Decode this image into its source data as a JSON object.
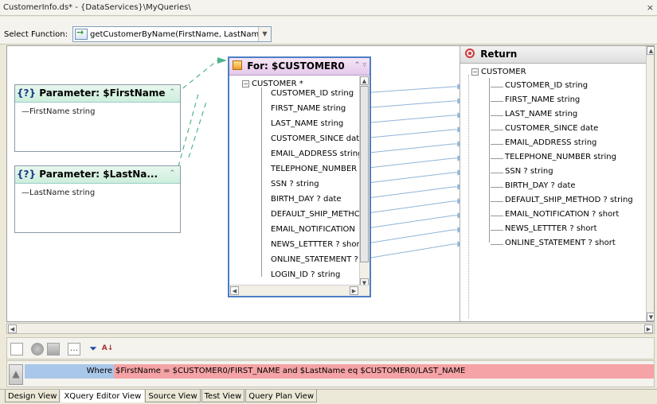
{
  "window": {
    "title": "CustomerInfo.ds* - {DataServices}\\MyQueries\\",
    "close_glyph": "×"
  },
  "function_bar": {
    "label": "Select Function:",
    "selected": "getCustomerByName(FirstName, LastName)"
  },
  "params": [
    {
      "title": "Parameter: $FirstName",
      "prefix": "{?}",
      "field": "FirstName string"
    },
    {
      "title": "Parameter: $LastNa...",
      "prefix": "{?}",
      "field": "LastName string"
    }
  ],
  "for_box": {
    "title": "For: $CUSTOMER0",
    "root": "CUSTOMER *",
    "items": [
      "CUSTOMER_ID string",
      "FIRST_NAME string",
      "LAST_NAME string",
      "CUSTOMER_SINCE dat",
      "EMAIL_ADDRESS string",
      "TELEPHONE_NUMBER s",
      "SSN ? string",
      "BIRTH_DAY ? date",
      "DEFAULT_SHIP_METHC",
      "EMAIL_NOTIFICATION",
      "NEWS_LETTTER ? shor",
      "ONLINE_STATEMENT ?",
      "LOGIN_ID ? string"
    ]
  },
  "return_box": {
    "title": "Return",
    "root": "CUSTOMER",
    "items": [
      "CUSTOMER_ID string",
      "FIRST_NAME string",
      "LAST_NAME string",
      "CUSTOMER_SINCE date",
      "EMAIL_ADDRESS string",
      "TELEPHONE_NUMBER string",
      "SSN ? string",
      "BIRTH_DAY ? date",
      "DEFAULT_SHIP_METHOD ? string",
      "EMAIL_NOTIFICATION ? short",
      "NEWS_LETTTER ? short",
      "ONLINE_STATEMENT ? short"
    ]
  },
  "where": {
    "keyword": "Where",
    "expression": "$FirstName = $CUSTOMER0/FIRST_NAME and $LastName eq $CUSTOMER0/LAST_NAME"
  },
  "tabs": [
    {
      "label": "Design View",
      "active": false
    },
    {
      "label": "XQuery Editor View",
      "active": true
    },
    {
      "label": "Source View",
      "active": false
    },
    {
      "label": "Test View",
      "active": false
    },
    {
      "label": "Query Plan View",
      "active": false
    }
  ],
  "colors": {
    "link_green": "#4fb38c",
    "link_blue": "#8fb4d9",
    "where_keyword_bg": "#a9c7e8",
    "where_expr_bg": "#f5a3a6"
  }
}
